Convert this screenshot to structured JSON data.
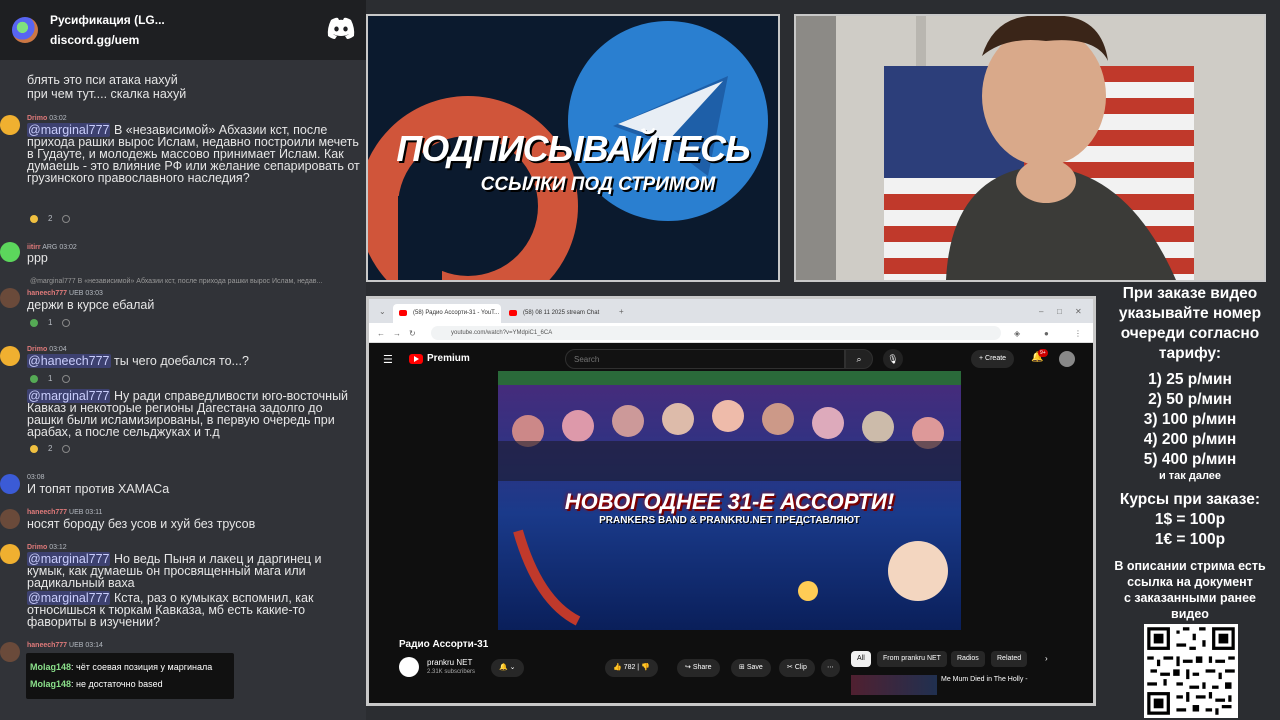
{
  "chat_header": {
    "server_name": "Русификация (LG...",
    "invite": "discord.gg/uem"
  },
  "messages": [
    {
      "lines": [
        "блять это пси атака нахуй",
        "при чем тут.... скалка нахуй"
      ]
    },
    {
      "user": "Drimo",
      "time": "03:02",
      "mention": "@marginal777",
      "text": " В «независимой» Абхазии кст, после прихода рашки вырос Ислам, недавно построили мечеть в Гудауте, и молодежь массово принимает Ислам. Как думаешь - это влияние РФ или желание сепарировать от грузинского православного наследия?",
      "reaction_count": "2"
    },
    {
      "user": "iitirr",
      "badge": "ARG",
      "time": "03:02",
      "text": "ррр"
    },
    {
      "reply": "@marginal777 В «независимой» Абхазии кст, после прихода рашки вырос Ислам, недав...",
      "user": "haneech777",
      "badge": "UEB",
      "time": "03:03",
      "text": "держи в курсе ебалай",
      "reaction_count": "1"
    },
    {
      "user": "Drimo",
      "time": "03:04",
      "mention": "@haneech777",
      "text": " ты чего доебался то...?",
      "reaction_count": "1"
    },
    {
      "mention": "@marginal777",
      "text": " Ну ради справедливости юго-восточный Кавказ и некоторые регионы Дагестана задолго до рашки были исламизированы, в первую очередь при арабах, а после сельджуках и т.д",
      "reaction_count": "2"
    },
    {
      "time": "03:08",
      "text": "И топят против ХАМАСа"
    },
    {
      "user": "haneech777",
      "badge": "UEB",
      "time": "03:11",
      "text": "носят бороду без усов и хуй без трусов"
    },
    {
      "user": "Drimo",
      "time": "03:12",
      "mention": "@marginal777",
      "text": " Но ведь Пыня и лакец и даргинец и кумык, как думаешь он просвященный мага или радикальный ваха"
    },
    {
      "mention": "@marginal777",
      "text": " Кста, раз о кумыках вспомнил, как относишься к тюркам Кавказа, мб есть какие-то фавориты в изучении?"
    },
    {
      "user": "haneech777",
      "badge": "UEB",
      "time": "03:14"
    }
  ],
  "twitch_chat": [
    {
      "user": "Molag148",
      "text": "чёт соевая позиция у маргинала"
    },
    {
      "user": "Molag148",
      "text": "не достаточно based"
    }
  ],
  "banner": {
    "title": "ПОДПИСЫВАЙТЕСЬ",
    "subtitle": "ССЫЛКИ ПОД СТРИМОМ"
  },
  "browser": {
    "tabs": [
      "(58) Радио Ассорти-31 - YouT...",
      "(58) 08 11 2025 stream Chat"
    ],
    "url": "youtube.com/watch?v=YMdpiC1_6CA"
  },
  "youtube": {
    "logo": "Premium",
    "search_placeholder": "Search",
    "create_label": "Create",
    "bell_badge": "9+",
    "thumb_title": "НОВОГОДНЕЕ 31-Е АССОРТИ!",
    "thumb_sub": "PRANKERS BAND & PRANKRU.NET ПРЕДСТАВЛЯЮТ",
    "video_title": "Радио Ассорти-31",
    "channel": "prankru NET",
    "subscribers": "2.31K subscribers",
    "likes": "782",
    "share": "Share",
    "save": "Save",
    "clip": "Clip",
    "chips": [
      "All",
      "From prankru NET",
      "Radios",
      "Related"
    ],
    "side_video": "Me Mum Died in The Holly -"
  },
  "info": {
    "intro": [
      "При заказе видео",
      "указывайте номер",
      "очереди согласно",
      "тарифу:"
    ],
    "tariffs": [
      "1) 25 р/мин",
      "2) 50 р/мин",
      "3) 100 р/мин",
      "4) 200 р/мин",
      "5) 400 р/мин"
    ],
    "etc": "и так далее",
    "rates_title": "Курсы при заказе:",
    "rates": [
      "1$ = 100р",
      "1€ = 100р"
    ],
    "desc": [
      "В описании стрима есть",
      "ссылка на документ",
      "с заказанными ранее",
      "видео"
    ]
  }
}
